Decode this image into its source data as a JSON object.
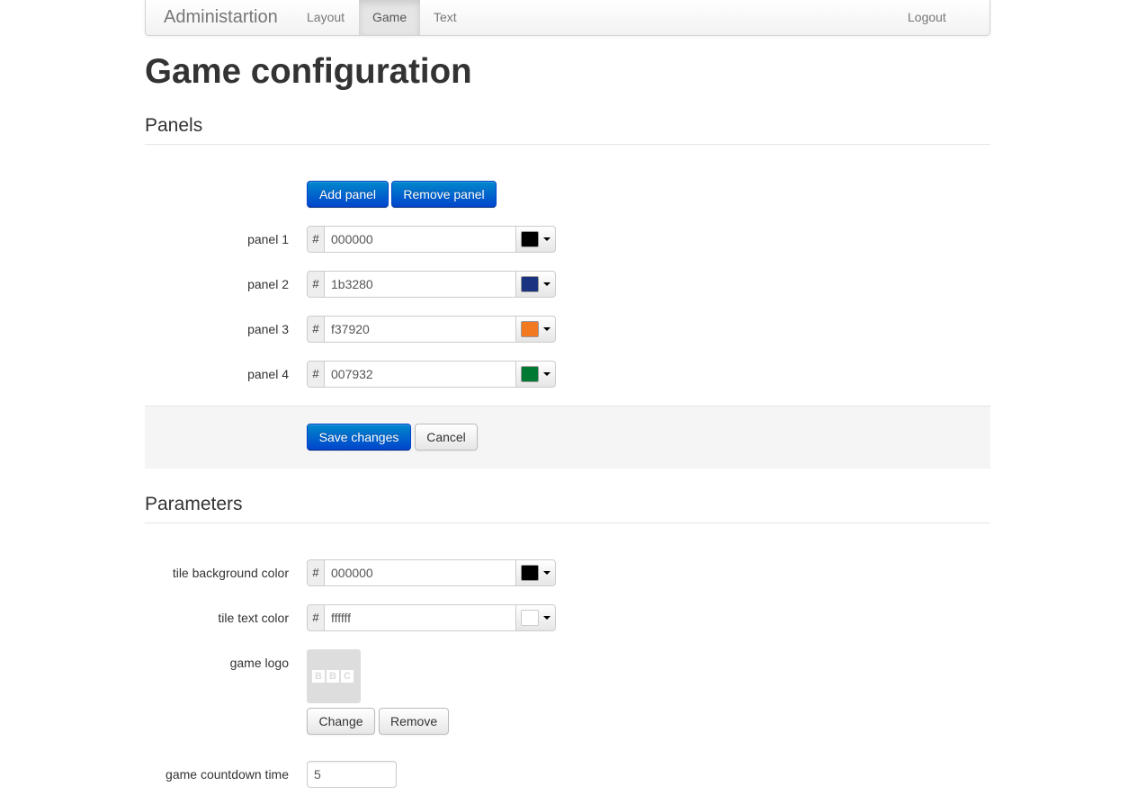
{
  "navbar": {
    "brand": "Administartion",
    "items": [
      "Layout",
      "Game",
      "Text"
    ],
    "active": "Game",
    "logout": "Logout"
  },
  "page_title": "Game configuration",
  "panels_section": {
    "title": "Panels",
    "add_button": "Add panel",
    "remove_button": "Remove panel",
    "hash": "#",
    "panels": [
      {
        "label": "panel 1",
        "value": "000000",
        "color": "#000000"
      },
      {
        "label": "panel 2",
        "value": "1b3280",
        "color": "#1b3280"
      },
      {
        "label": "panel 3",
        "value": "f37920",
        "color": "#f37920"
      },
      {
        "label": "panel 4",
        "value": "007932",
        "color": "#007932"
      }
    ],
    "save_button": "Save changes",
    "cancel_button": "Cancel"
  },
  "parameters_section": {
    "title": "Parameters",
    "tile_bg": {
      "label": "tile background color",
      "value": "000000",
      "color": "#000000"
    },
    "tile_text": {
      "label": "tile text color",
      "value": "ffffff",
      "color": "#ffffff"
    },
    "logo": {
      "label": "game logo",
      "letters": [
        "B",
        "B",
        "C"
      ],
      "change_button": "Change",
      "remove_button": "Remove"
    },
    "countdown": {
      "label": "game countdown time",
      "value": "5"
    }
  },
  "colors": {
    "primary": "#0055cc",
    "navbar_bg": "#f2f2f2"
  }
}
